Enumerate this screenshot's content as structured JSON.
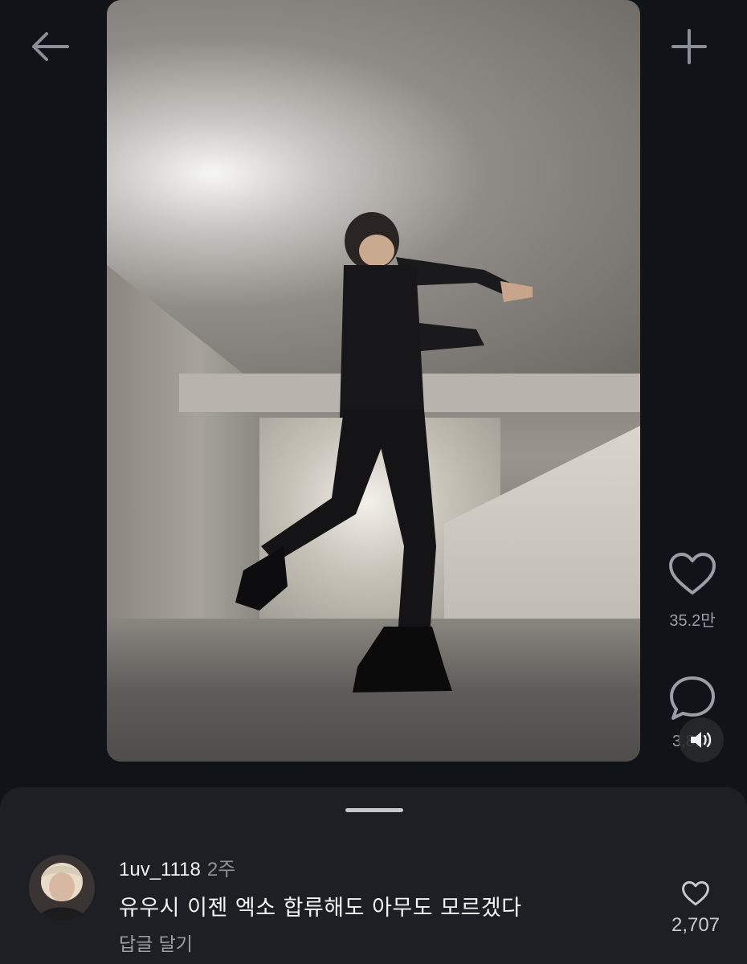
{
  "header": {
    "back_icon": "arrow-left-icon",
    "add_icon": "plus-icon"
  },
  "video": {
    "content": "Person in black outfit dancing in a concrete underground corridor"
  },
  "actions": {
    "likes": "35.2만",
    "comments": "3,815",
    "like_icon": "heart-outline-icon",
    "comment_icon": "speech-bubble-icon",
    "sound_icon": "speaker-icon"
  },
  "comment": {
    "username": "1uv_1118",
    "time": "2주",
    "text": "유우시 이젠 엑소 합류해도 아무도 모르겠다",
    "reply_label": "답글 달기",
    "likes": "2,707"
  },
  "colors": {
    "background": "#101318",
    "sheet": "#1d1f24",
    "muted_text": "#9a9ea6"
  }
}
